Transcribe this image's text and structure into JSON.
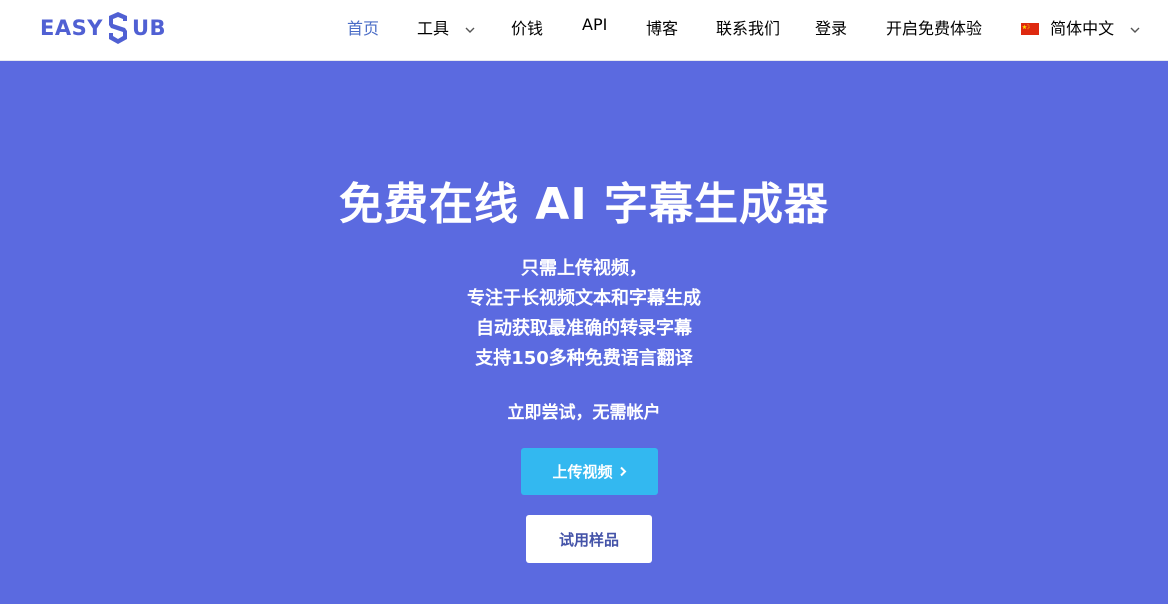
{
  "brand": {
    "logo_left": "EASY",
    "logo_right": "UB",
    "logo_color": "#5060d3"
  },
  "nav": {
    "items": [
      {
        "label": "首页",
        "active": true
      },
      {
        "label": "工具",
        "has_dropdown": true
      },
      {
        "label": "价钱"
      },
      {
        "label": "API"
      },
      {
        "label": "博客"
      },
      {
        "label": "联系我们"
      },
      {
        "label": "登录"
      },
      {
        "label": "开启免费体验"
      }
    ],
    "language": {
      "label": "简体中文",
      "flag_icon": "china-flag-icon"
    },
    "active_color": "#4a6cc6"
  },
  "hero": {
    "background": "#5b6ae0",
    "title": "免费在线 AI 字幕生成器",
    "lines": [
      "只需上传视频，",
      "专注于长视频文本和字幕生成",
      "自动获取最准确的转录字幕",
      "支持150多种免费语言翻译"
    ],
    "trial_text": "立即尝试，无需帐户",
    "upload_button": {
      "label": "上传视频",
      "icon": "chevron-right-icon",
      "color": "#33b8f0"
    },
    "sample_button": {
      "label": "试用样品"
    }
  }
}
